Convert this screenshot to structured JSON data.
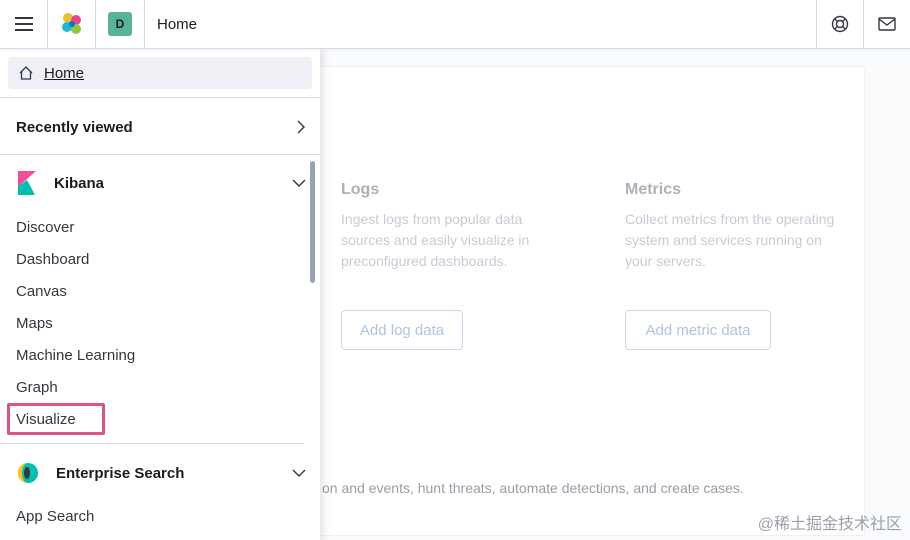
{
  "header": {
    "title": "Home",
    "space_initial": "D"
  },
  "nav": {
    "home_label": "Home",
    "recently_viewed": "Recently viewed",
    "kibana": {
      "label": "Kibana",
      "items": [
        "Discover",
        "Dashboard",
        "Canvas",
        "Maps",
        "Machine Learning",
        "Graph",
        "Visualize"
      ]
    },
    "enterprise_search": {
      "label": "Enterprise Search",
      "items": [
        "App Search"
      ]
    }
  },
  "background": {
    "logs": {
      "title": "Logs",
      "description": [
        "Ingest logs from popular data",
        "sources and easily visualize in",
        "preconfigured dashboards."
      ],
      "button": "Add log data"
    },
    "metrics": {
      "title": "Metrics",
      "description": [
        "Collect metrics from the operating",
        "system and services running on",
        "your servers."
      ],
      "button": "Add metric data"
    },
    "footer_text": "on and events, hunt threats, automate detections, and create cases."
  },
  "watermark": "@稀土掘金技术社区",
  "colors": {
    "accent_highlight": "#e0557f",
    "avatar_bg": "#54b399"
  }
}
